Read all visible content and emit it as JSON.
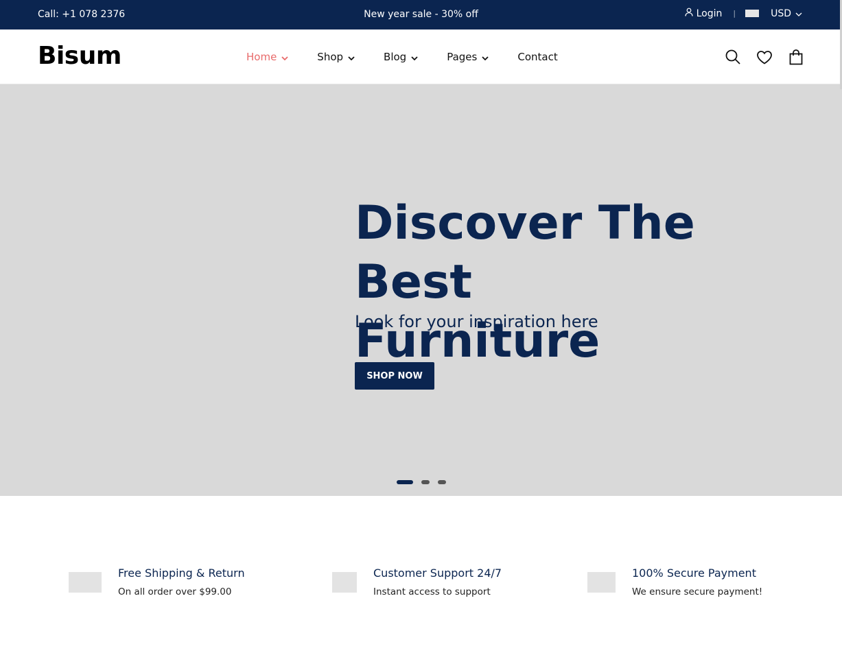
{
  "topbar": {
    "call": "Call: +1 078 2376",
    "promo": "New year sale - 30% off",
    "login": "Login",
    "separator": "|",
    "currency": "USD"
  },
  "header": {
    "logo": "Bisum",
    "nav": [
      {
        "label": "Home",
        "dropdown": true,
        "active": true
      },
      {
        "label": "Shop",
        "dropdown": true
      },
      {
        "label": "Blog",
        "dropdown": true
      },
      {
        "label": "Pages",
        "dropdown": true
      },
      {
        "label": "Contact",
        "dropdown": false
      }
    ],
    "icons": [
      "search-icon",
      "heart-icon",
      "bag-icon"
    ]
  },
  "hero": {
    "title_line1": "Discover The Best",
    "title_line2": "Furniture",
    "subtitle": "Look for your inspiration here",
    "button": "SHOP NOW",
    "slides_count": 3,
    "active_slide": 1
  },
  "features": [
    {
      "title": "Free Shipping & Return",
      "desc": "On all order over $99.00"
    },
    {
      "title": "Customer Support 24/7",
      "desc": "Instant access to support"
    },
    {
      "title": "100% Secure Payment",
      "desc": "We ensure secure payment!"
    }
  ],
  "colors": {
    "navy": "#0b2550",
    "accent": "#e86a6a",
    "hero_bg": "#d9d9d9"
  }
}
